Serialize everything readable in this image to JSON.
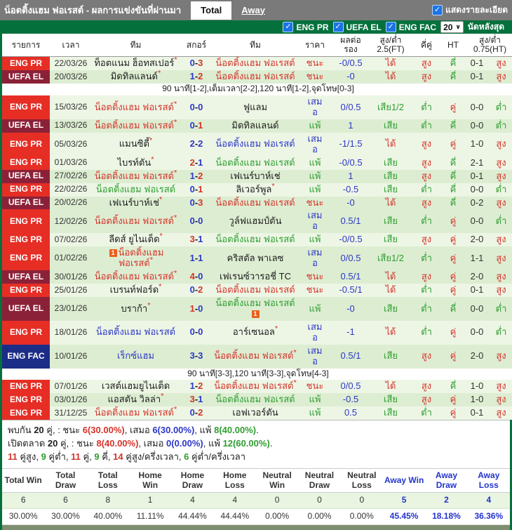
{
  "colors": {
    "win_red": "#d5342b",
    "draw_blue": "#2d37c8",
    "loss_green": "#2f9e31",
    "handicap_blue": "#2d37c8",
    "badge_eng_pr": "#e62e25",
    "badge_uefa_el": "#8b2138",
    "badge_eng_fac": "#1b2d87",
    "bar_green": "#04713c",
    "bar_gray": "#7a7a7a",
    "stripe_light": "#edf6e5",
    "stripe_dark": "#ddedd2",
    "checkbox_blue": "#1a73e8",
    "away_highlight": "#2233cc"
  },
  "top_bar": {
    "title": "น็อตติ้งแฮม ฟอเรสต์ - ผลการแข่งขันที่ผ่านมา",
    "tab_total": "Total",
    "tab_away": "Away",
    "detail_label": "แสดงรายละเอียด",
    "check_glyph": "✓"
  },
  "filter_bar": {
    "leagues": [
      "ENG PR",
      "UEFA EL",
      "ENG FAC"
    ],
    "match_count": "20",
    "caret_glyph": "∨",
    "suffix_label": "นัดหลังสุด",
    "check_glyph": "✓"
  },
  "table": {
    "headers": [
      "รายการ",
      "เวลา",
      "ทีม",
      "สกอร์",
      "ทีม",
      "ราคา",
      "ผลต่อ\nรอง",
      "สูง/ต่ำ\n2.5(FT)",
      "คี่คู่",
      "HT",
      "สูง/ต่ำ\n0.75(HT)"
    ],
    "rows": [
      {
        "type": "match",
        "league": "ENG PR",
        "lg": "pr",
        "date": "22/03/26",
        "t1": "ท็อตแนม ฮ็อทสเปอร์",
        "t1c": "k",
        "t1s": true,
        "s1": "0",
        "s1c": "b",
        "s2": "3",
        "s2c": "r",
        "t2": "น็อตติ้งแฮม ฟอเรสต์",
        "t2c": "r",
        "t2s": false,
        "res": "ชนะ",
        "resc": "r",
        "hc": "-0/0.5",
        "hr": "ได้",
        "hrc": "r",
        "ou": "สูง",
        "ouc": "r",
        "oe": "คี่",
        "oec": "g",
        "ht": "0-1",
        "ouh": "สูง",
        "ouhc": "r",
        "stripe": "l"
      },
      {
        "type": "match",
        "league": "UEFA EL",
        "lg": "el",
        "date": "20/03/26",
        "t1": "มิดทิลแลนด์",
        "t1c": "k",
        "t1s": true,
        "s1": "1",
        "s1c": "b",
        "s2": "2",
        "s2c": "r",
        "t2": "น็อตติ้งแฮม ฟอเรสต์",
        "t2c": "r",
        "t2s": false,
        "res": "ชนะ",
        "resc": "r",
        "hc": "-0",
        "hr": "ได้",
        "hrc": "r",
        "ou": "สูง",
        "ouc": "r",
        "oe": "คี่",
        "oec": "g",
        "ht": "0-1",
        "ouh": "สูง",
        "ouhc": "r",
        "stripe": "d"
      },
      {
        "type": "note",
        "text": "90 นาที[1-2],เต็มเวลา[2-2],120 นาที[1-2],จุดโทษ[0-3]"
      },
      {
        "type": "match",
        "league": "ENG PR",
        "lg": "pr",
        "date": "15/03/26",
        "t1": "น็อตติ้งแฮม ฟอเรสต์",
        "t1c": "r",
        "t1s": true,
        "s1": "0",
        "s1c": "b",
        "s2": "0",
        "s2c": "b",
        "t2": "ฟูแลม",
        "t2c": "k",
        "t2s": false,
        "res": "เสม\nอ",
        "resc": "b",
        "hc": "0/0.5",
        "hr": "เสีย1/2",
        "hrc": "g",
        "ou": "ต่ำ",
        "ouc": "g",
        "oe": "คู่",
        "oec": "r",
        "ht": "0-0",
        "ouh": "ต่ำ",
        "ouhc": "g",
        "stripe": "l"
      },
      {
        "type": "match",
        "league": "UEFA EL",
        "lg": "el",
        "date": "13/03/26",
        "t1": "น็อตติ้งแฮม ฟอเรสต์",
        "t1c": "r",
        "t1s": true,
        "s1": "0",
        "s1c": "b",
        "s2": "1",
        "s2c": "r",
        "t2": "มิดทิลแลนด์",
        "t2c": "k",
        "t2s": false,
        "res": "แพ้",
        "resc": "g",
        "hc": "1",
        "hr": "เสีย",
        "hrc": "g",
        "ou": "ต่ำ",
        "ouc": "g",
        "oe": "คี่",
        "oec": "g",
        "ht": "0-0",
        "ouh": "ต่ำ",
        "ouhc": "g",
        "stripe": "d"
      },
      {
        "type": "match",
        "league": "ENG PR",
        "lg": "pr",
        "date": "05/03/26",
        "t1": "แมนซิตี้",
        "t1c": "k",
        "t1s": true,
        "s1": "2",
        "s1c": "b",
        "s2": "2",
        "s2c": "b",
        "t2": "น็อตติ้งแฮม ฟอเรสต์",
        "t2c": "b",
        "t2s": false,
        "res": "เสม\nอ",
        "resc": "b",
        "hc": "-1/1.5",
        "hr": "ได้",
        "hrc": "r",
        "ou": "สูง",
        "ouc": "r",
        "oe": "คู่",
        "oec": "r",
        "ht": "1-0",
        "ouh": "สูง",
        "ouhc": "r",
        "stripe": "l"
      },
      {
        "type": "match",
        "league": "ENG PR",
        "lg": "pr",
        "date": "01/03/26",
        "t1": "ไบรท์ตัน",
        "t1c": "k",
        "t1s": true,
        "s1": "2",
        "s1c": "r",
        "s2": "1",
        "s2c": "b",
        "t2": "น็อตติ้งแฮม ฟอเรสต์",
        "t2c": "g",
        "t2s": false,
        "res": "แพ้",
        "resc": "g",
        "hc": "-0/0.5",
        "hr": "เสีย",
        "hrc": "g",
        "ou": "สูง",
        "ouc": "r",
        "oe": "คี่",
        "oec": "g",
        "ht": "2-1",
        "ouh": "สูง",
        "ouhc": "r",
        "stripe": "l"
      },
      {
        "type": "match",
        "league": "UEFA EL",
        "lg": "el",
        "date": "27/02/26",
        "t1": "น็อตติ้งแฮม ฟอเรสต์",
        "t1c": "r",
        "t1s": true,
        "s1": "1",
        "s1c": "b",
        "s2": "2",
        "s2c": "r",
        "t2": "เฟเนร์บาห์เช่",
        "t2c": "k",
        "t2s": false,
        "res": "แพ้",
        "resc": "g",
        "hc": "1",
        "hr": "เสีย",
        "hrc": "g",
        "ou": "สูง",
        "ouc": "r",
        "oe": "คี่",
        "oec": "g",
        "ht": "0-1",
        "ouh": "สูง",
        "ouhc": "r",
        "stripe": "d"
      },
      {
        "type": "match",
        "league": "ENG PR",
        "lg": "pr",
        "date": "22/02/26",
        "t1": "น็อตติ้งแฮม ฟอเรสต์",
        "t1c": "g",
        "t1s": false,
        "s1": "0",
        "s1c": "b",
        "s2": "1",
        "s2c": "r",
        "t2": "ลิเวอร์พูล",
        "t2c": "k",
        "t2s": true,
        "res": "แพ้",
        "resc": "g",
        "hc": "-0.5",
        "hr": "เสีย",
        "hrc": "g",
        "ou": "ต่ำ",
        "ouc": "g",
        "oe": "คี่",
        "oec": "g",
        "ht": "0-0",
        "ouh": "ต่ำ",
        "ouhc": "g",
        "stripe": "l"
      },
      {
        "type": "match",
        "league": "UEFA EL",
        "lg": "el",
        "date": "20/02/26",
        "t1": "เฟเนร์บาห์เช่",
        "t1c": "k",
        "t1s": true,
        "s1": "0",
        "s1c": "b",
        "s2": "3",
        "s2c": "r",
        "t2": "น็อตติ้งแฮม ฟอเรสต์",
        "t2c": "r",
        "t2s": false,
        "res": "ชนะ",
        "resc": "r",
        "hc": "-0",
        "hr": "ได้",
        "hrc": "r",
        "ou": "สูง",
        "ouc": "r",
        "oe": "คี่",
        "oec": "g",
        "ht": "0-2",
        "ouh": "สูง",
        "ouhc": "r",
        "stripe": "d"
      },
      {
        "type": "match",
        "league": "ENG PR",
        "lg": "pr",
        "date": "12/02/26",
        "t1": "น็อตติ้งแฮม ฟอเรสต์",
        "t1c": "r",
        "t1s": true,
        "s1": "0",
        "s1c": "b",
        "s2": "0",
        "s2c": "b",
        "t2": "วูล์ฟแฮมป์ตัน",
        "t2c": "k",
        "t2s": false,
        "res": "เสม\nอ",
        "resc": "b",
        "hc": "0.5/1",
        "hr": "เสีย",
        "hrc": "g",
        "ou": "ต่ำ",
        "ouc": "g",
        "oe": "คู่",
        "oec": "r",
        "ht": "0-0",
        "ouh": "ต่ำ",
        "ouhc": "g",
        "stripe": "d"
      },
      {
        "type": "match",
        "league": "ENG PR",
        "lg": "pr",
        "date": "07/02/26",
        "t1": "ลีดส์ ยูไนเต็ด",
        "t1c": "k",
        "t1s": true,
        "s1": "3",
        "s1c": "r",
        "s2": "1",
        "s2c": "b",
        "t2": "น็อตติ้งแฮม ฟอเรสต์",
        "t2c": "g",
        "t2s": false,
        "res": "แพ้",
        "resc": "g",
        "hc": "-0/0.5",
        "hr": "เสีย",
        "hrc": "g",
        "ou": "สูง",
        "ouc": "r",
        "oe": "คู่",
        "oec": "r",
        "ht": "2-0",
        "ouh": "สูง",
        "ouhc": "r",
        "stripe": "l"
      },
      {
        "type": "match",
        "league": "ENG PR",
        "lg": "pr",
        "date": "01/02/26",
        "t1": "น็อตติ้งแฮม ฟอเรสต์",
        "t1c": "r",
        "t1s": true,
        "t1card": "1",
        "s1": "1",
        "s1c": "b",
        "s2": "1",
        "s2c": "b",
        "t2": "คริสตัล พาเลซ",
        "t2c": "k",
        "t2s": false,
        "res": "เสม\nอ",
        "resc": "b",
        "hc": "0/0.5",
        "hr": "เสีย1/2",
        "hrc": "g",
        "ou": "ต่ำ",
        "ouc": "g",
        "oe": "คู่",
        "oec": "r",
        "ht": "1-1",
        "ouh": "สูง",
        "ouhc": "r",
        "stripe": "d"
      },
      {
        "type": "match",
        "league": "UEFA EL",
        "lg": "el",
        "date": "30/01/26",
        "t1": "น็อตติ้งแฮม ฟอเรสต์",
        "t1c": "r",
        "t1s": true,
        "s1": "4",
        "s1c": "r",
        "s2": "0",
        "s2c": "b",
        "t2": "เฟเรนซ์วารอชี่ TC",
        "t2c": "k",
        "t2s": false,
        "res": "ชนะ",
        "resc": "r",
        "hc": "0.5/1",
        "hr": "ได้",
        "hrc": "r",
        "ou": "สูง",
        "ouc": "r",
        "oe": "คู่",
        "oec": "r",
        "ht": "2-0",
        "ouh": "สูง",
        "ouhc": "r",
        "stripe": "d"
      },
      {
        "type": "match",
        "league": "ENG PR",
        "lg": "pr",
        "date": "25/01/26",
        "t1": "เบรนท์ฟอร์ด",
        "t1c": "k",
        "t1s": true,
        "s1": "0",
        "s1c": "b",
        "s2": "2",
        "s2c": "r",
        "t2": "น็อตติ้งแฮม ฟอเรสต์",
        "t2c": "r",
        "t2s": false,
        "res": "ชนะ",
        "resc": "r",
        "hc": "-0.5/1",
        "hr": "ได้",
        "hrc": "r",
        "ou": "ต่ำ",
        "ouc": "g",
        "oe": "คู่",
        "oec": "r",
        "ht": "0-1",
        "ouh": "สูง",
        "ouhc": "r",
        "stripe": "l"
      },
      {
        "type": "match",
        "league": "UEFA EL",
        "lg": "el",
        "date": "23/01/26",
        "t1": "บราก้า",
        "t1c": "k",
        "t1s": true,
        "s1": "1",
        "s1c": "r",
        "s2": "0",
        "s2c": "b",
        "t2": "น็อตติ้งแฮม ฟอเรสต์",
        "t2c": "g",
        "t2s": false,
        "t2card": "1",
        "res": "แพ้",
        "resc": "g",
        "hc": "-0",
        "hr": "เสีย",
        "hrc": "g",
        "ou": "ต่ำ",
        "ouc": "g",
        "oe": "คี่",
        "oec": "g",
        "ht": "0-0",
        "ouh": "ต่ำ",
        "ouhc": "g",
        "stripe": "d"
      },
      {
        "type": "match",
        "league": "ENG PR",
        "lg": "pr",
        "date": "18/01/26",
        "t1": "น็อตติ้งแฮม ฟอเรสต์",
        "t1c": "b",
        "t1s": false,
        "s1": "0",
        "s1c": "b",
        "s2": "0",
        "s2c": "b",
        "t2": "อาร์เซนอล",
        "t2c": "k",
        "t2s": true,
        "res": "เสม\nอ",
        "resc": "b",
        "hc": "-1",
        "hr": "ได้",
        "hrc": "r",
        "ou": "ต่ำ",
        "ouc": "g",
        "oe": "คู่",
        "oec": "r",
        "ht": "0-0",
        "ouh": "ต่ำ",
        "ouhc": "g",
        "stripe": "l"
      },
      {
        "type": "match",
        "league": "ENG FAC",
        "lg": "fac",
        "date": "10/01/26",
        "t1": "เร็กซ์แฮม",
        "t1c": "b",
        "t1s": false,
        "s1": "3",
        "s1c": "b",
        "s2": "3",
        "s2c": "b",
        "t2": "น็อตติ้งแฮม ฟอเรสต์",
        "t2c": "r",
        "t2s": true,
        "res": "เสม\nอ",
        "resc": "b",
        "hc": "0.5/1",
        "hr": "เสีย",
        "hrc": "g",
        "ou": "สูง",
        "ouc": "r",
        "oe": "คู่",
        "oec": "r",
        "ht": "2-0",
        "ouh": "สูง",
        "ouhc": "r",
        "stripe": "d"
      },
      {
        "type": "note",
        "text": "90 นาที[3-3],120 นาที[3-3],จุดโทษ[4-3]"
      },
      {
        "type": "match",
        "league": "ENG PR",
        "lg": "pr",
        "date": "07/01/26",
        "t1": "เวสต์แฮมยูไนเต็ด",
        "t1c": "k",
        "t1s": false,
        "s1": "1",
        "s1c": "b",
        "s2": "2",
        "s2c": "r",
        "t2": "น็อตติ้งแฮม ฟอเรสต์",
        "t2c": "r",
        "t2s": true,
        "res": "ชนะ",
        "resc": "r",
        "hc": "0/0.5",
        "hr": "ได้",
        "hrc": "r",
        "ou": "สูง",
        "ouc": "r",
        "oe": "คี่",
        "oec": "g",
        "ht": "1-0",
        "ouh": "สูง",
        "ouhc": "r",
        "stripe": "l"
      },
      {
        "type": "match",
        "league": "ENG PR",
        "lg": "pr",
        "date": "03/01/26",
        "t1": "แอสตัน วิลล่า",
        "t1c": "k",
        "t1s": true,
        "s1": "3",
        "s1c": "r",
        "s2": "1",
        "s2c": "b",
        "t2": "น็อตติ้งแฮม ฟอเรสต์",
        "t2c": "g",
        "t2s": false,
        "res": "แพ้",
        "resc": "g",
        "hc": "-0.5",
        "hr": "เสีย",
        "hrc": "g",
        "ou": "สูง",
        "ouc": "r",
        "oe": "คู่",
        "oec": "r",
        "ht": "1-0",
        "ouh": "สูง",
        "ouhc": "r",
        "stripe": "d"
      },
      {
        "type": "match",
        "league": "ENG PR",
        "lg": "pr",
        "date": "31/12/25",
        "t1": "น็อตติ้งแฮม ฟอเรสต์",
        "t1c": "r",
        "t1s": true,
        "s1": "0",
        "s1c": "b",
        "s2": "2",
        "s2c": "r",
        "t2": "เอฟเวอร์ตัน",
        "t2c": "k",
        "t2s": false,
        "res": "แพ้",
        "resc": "g",
        "hc": "0.5",
        "hr": "เสีย",
        "hrc": "g",
        "ou": "ต่ำ",
        "ouc": "g",
        "oe": "คู่",
        "oec": "r",
        "ht": "0-1",
        "ouh": "สูง",
        "ouhc": "r",
        "stripe": "l"
      }
    ]
  },
  "summary": {
    "lines": [
      [
        {
          "t": "พบกัน "
        },
        {
          "t": "20",
          "b": true
        },
        {
          "t": " คู่, : ชนะ "
        },
        {
          "t": "6(30.00%)",
          "c": "r",
          "b": true
        },
        {
          "t": ", เสมอ "
        },
        {
          "t": "6(30.00%)",
          "c": "b",
          "b": true
        },
        {
          "t": ", แพ้ "
        },
        {
          "t": "8(40.00%)",
          "c": "g",
          "b": true
        },
        {
          "t": "."
        }
      ],
      [
        {
          "t": "เปิดตลาด "
        },
        {
          "t": "20",
          "b": true
        },
        {
          "t": " คู่, : ชนะ "
        },
        {
          "t": "8(40.00%)",
          "c": "r",
          "b": true
        },
        {
          "t": ", เสมอ "
        },
        {
          "t": "0(0.00%)",
          "c": "b",
          "b": true
        },
        {
          "t": ", แพ้ "
        },
        {
          "t": "12(60.00%)",
          "c": "g",
          "b": true
        },
        {
          "t": "."
        }
      ],
      [
        {
          "t": "11",
          "c": "r",
          "b": true
        },
        {
          "t": " คู่สูง, "
        },
        {
          "t": "9",
          "c": "g",
          "b": true
        },
        {
          "t": " คู่ต่ำ, "
        },
        {
          "t": "11",
          "c": "r",
          "b": true
        },
        {
          "t": " คู่, "
        },
        {
          "t": "9",
          "c": "g",
          "b": true
        },
        {
          "t": " คี่, "
        },
        {
          "t": "14",
          "c": "r",
          "b": true
        },
        {
          "t": " คู่สูง/ครึ่งเวลา, "
        },
        {
          "t": "6",
          "c": "g",
          "b": true
        },
        {
          "t": " คู่ต่ำ/ครึ่งเวลา"
        }
      ]
    ]
  },
  "stats_table": {
    "headers": [
      "Total Win",
      "Total Draw",
      "Total Loss",
      "Home Win",
      "Home Draw",
      "Home Loss",
      "Neutral Win",
      "Neutral Draw",
      "Neutral Loss",
      "Away Win",
      "Away Draw",
      "Away Loss"
    ],
    "counts": [
      "6",
      "6",
      "8",
      "1",
      "4",
      "4",
      "0",
      "0",
      "0",
      "5",
      "2",
      "4"
    ],
    "percents": [
      "30.00%",
      "30.00%",
      "40.00%",
      "11.11%",
      "44.44%",
      "44.44%",
      "0.00%",
      "0.00%",
      "0.00%",
      "45.45%",
      "18.18%",
      "36.36%"
    ],
    "highlight_from_index": 9
  }
}
